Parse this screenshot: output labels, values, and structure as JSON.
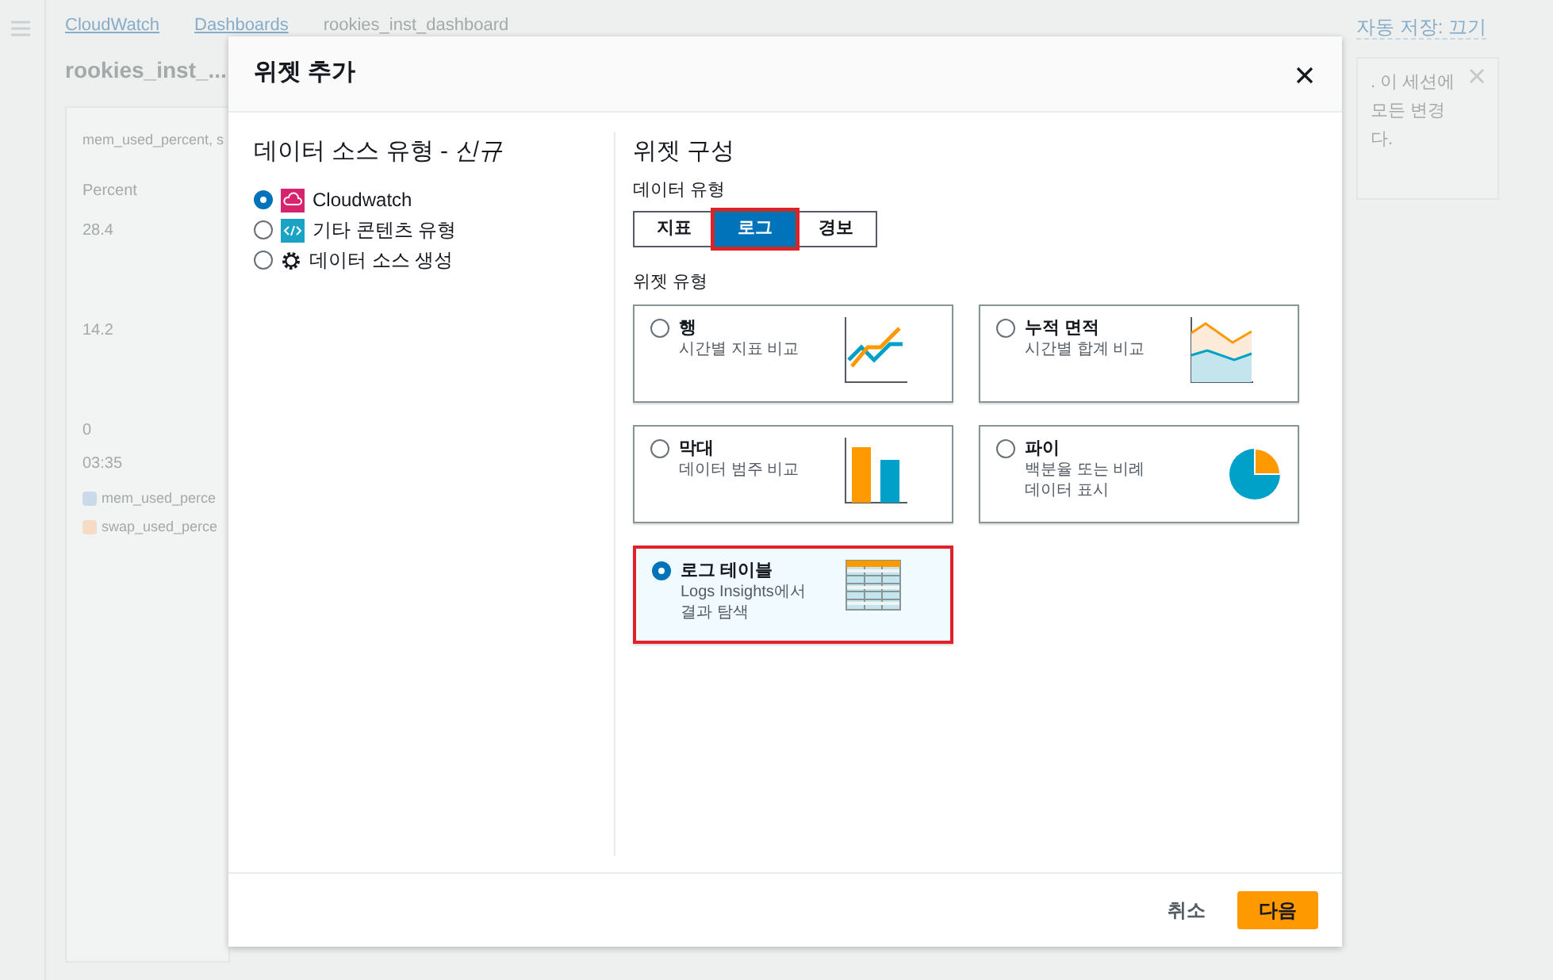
{
  "background": {
    "breadcrumbs": [
      "CloudWatch",
      "Dashboards",
      "rookies_inst_dashboard"
    ],
    "dashboard_title": "rookies_inst_...",
    "autosave_link": "자동 저장: 끄기",
    "widget_title": "mem_used_percent, s",
    "y_axis_label": "Percent",
    "y_ticks": [
      "28.4",
      "14.2",
      "0"
    ],
    "x_tick": "03:35",
    "legend": [
      {
        "label": "mem_used_perce",
        "color": "#c9dbe8"
      },
      {
        "label": "swap_used_perce",
        "color": "#f6dcc4"
      }
    ],
    "notice_lines": [
      ". 이 세션에",
      "모든 변경",
      "다."
    ]
  },
  "modal": {
    "title": "위젯 추가",
    "source_heading": "데이터 소스 유형 - *신규*",
    "sources": [
      {
        "label": "Cloudwatch",
        "kind": "cloudwatch",
        "selected": true
      },
      {
        "label": "기타 콘텐츠 유형",
        "kind": "code",
        "selected": false
      },
      {
        "label": "데이터 소스 생성",
        "kind": "gear",
        "selected": false
      }
    ],
    "config_heading": "위젯 구성",
    "data_type_label": "데이터 유형",
    "data_types": [
      {
        "label": "지표",
        "selected": false
      },
      {
        "label": "로그",
        "selected": true
      },
      {
        "label": "경보",
        "selected": false
      }
    ],
    "widget_type_label": "위젯 유형",
    "widget_types": [
      {
        "label": "행",
        "description": "시간별 지표 비교",
        "kind": "line",
        "selected": false
      },
      {
        "label": "누적 면적",
        "description": "시간별 합계 비교",
        "kind": "area",
        "selected": false
      },
      {
        "label": "막대",
        "description": "데이터 범주 비교",
        "kind": "bar",
        "selected": false
      },
      {
        "label": "파이",
        "description": "백분율 또는 비례 데이터 표시",
        "kind": "pie",
        "selected": false
      },
      {
        "label": "로그 테이블",
        "description": "Logs Insights에서 결과 탐색",
        "kind": "table",
        "selected": true
      }
    ],
    "cancel_button": "취소",
    "next_button": "다음"
  }
}
